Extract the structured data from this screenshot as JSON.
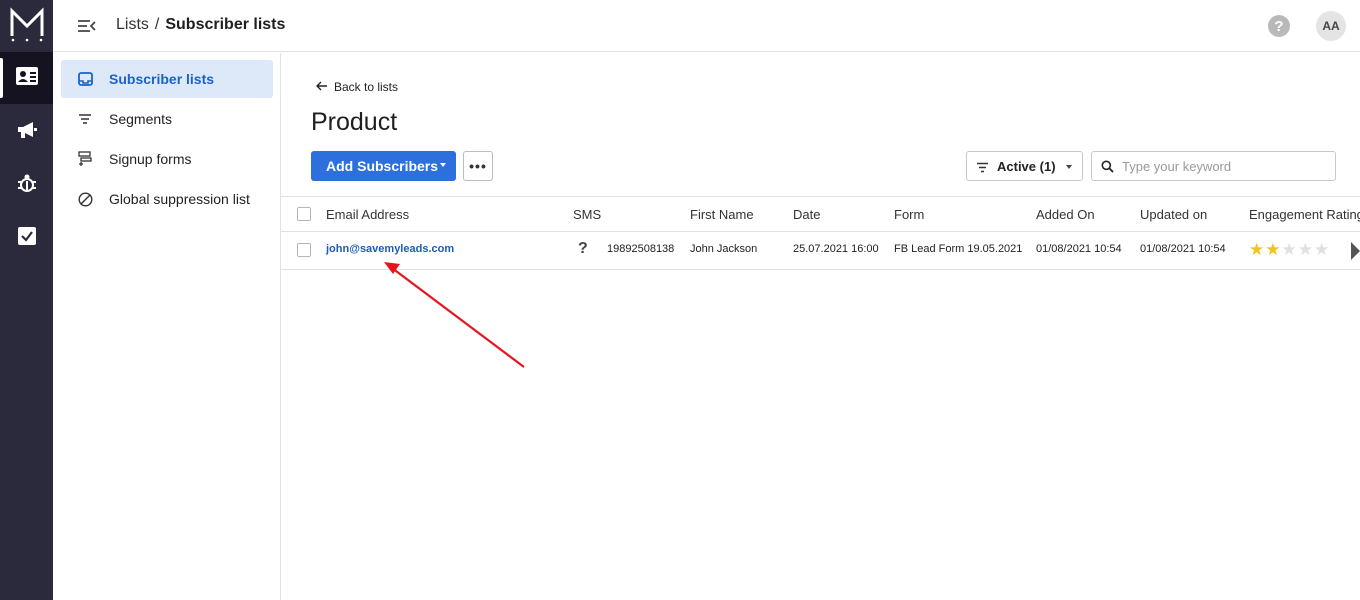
{
  "app": {
    "logo_icon": "m-logo-icon"
  },
  "rail": {
    "items": [
      {
        "icon": "subscribers-icon",
        "active": true
      },
      {
        "icon": "megaphone-icon",
        "active": false
      },
      {
        "icon": "automation-bug-icon",
        "active": false
      },
      {
        "icon": "checkbox-icon",
        "active": false
      }
    ]
  },
  "header": {
    "breadcrumb": {
      "parent": "Lists",
      "separator": "/",
      "current": "Subscriber lists"
    },
    "help_label": "?",
    "avatar_initials": "AA"
  },
  "subnav": {
    "items": [
      {
        "label": "Subscriber lists",
        "icon": "inbox-icon",
        "active": true
      },
      {
        "label": "Segments",
        "icon": "filter-lines-icon",
        "active": false
      },
      {
        "label": "Signup forms",
        "icon": "form-icon",
        "active": false
      },
      {
        "label": "Global suppression list",
        "icon": "block-icon",
        "active": false
      }
    ]
  },
  "main": {
    "back_label": "Back to lists",
    "title": "Product",
    "add_button_label": "Add Subscribers",
    "more_label": "•••",
    "filter_label": "Active (1)",
    "search_placeholder": "Type your keyword",
    "search_value": ""
  },
  "table": {
    "columns": [
      "Email Address",
      "SMS",
      "First Name",
      "Date",
      "Form",
      "Added On",
      "Updated on",
      "Engagement Rating"
    ],
    "rows": [
      {
        "email": "john@savemyleads.com",
        "sms_icon": "question-mark-icon",
        "sms_symbol": "?",
        "sms_number": "19892508138",
        "first_name": "John Jackson",
        "date": "25.07.2021 16:00",
        "form": "FB Lead Form 19.05.2021",
        "added_on": "01/08/2021 10:54",
        "updated_on": "01/08/2021 10:54",
        "rating": 2,
        "rating_max": 5
      }
    ]
  },
  "colors": {
    "rail_bg": "#2b2a3d",
    "accent": "#2d6fdc",
    "active_nav_bg": "#dde9f9",
    "link": "#1b5db8",
    "star": "#f0c419",
    "annotation_arrow": "#e8141b"
  }
}
